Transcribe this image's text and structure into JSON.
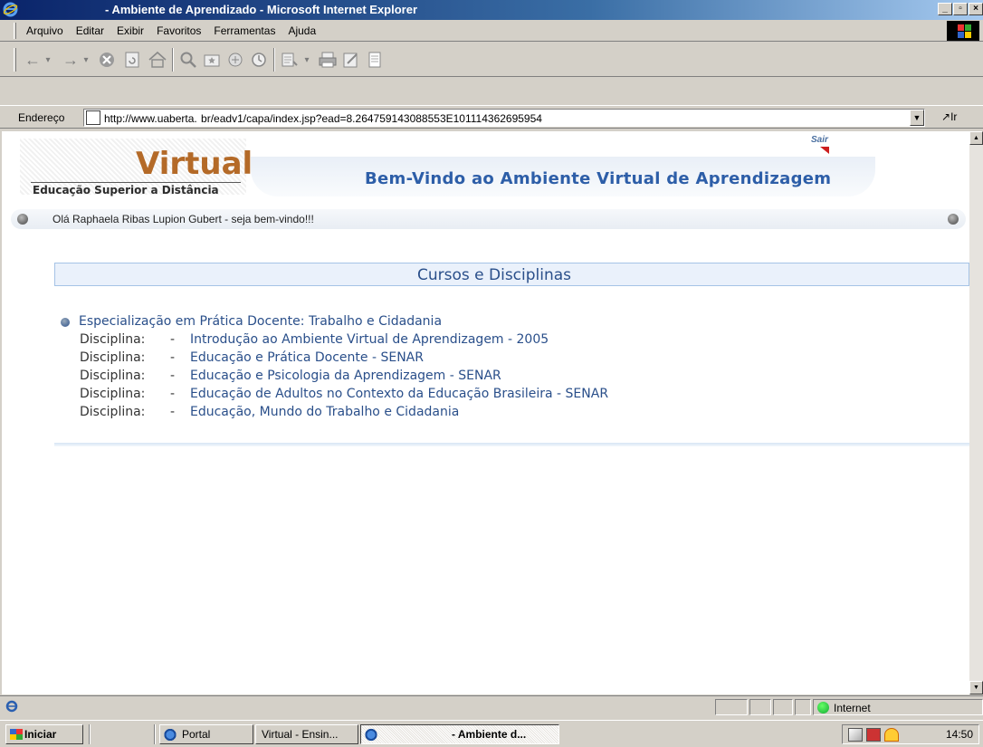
{
  "window": {
    "title": "- Ambiente de Aprendizado - Microsoft Internet Explorer",
    "caption_buttons": [
      "_",
      "▫",
      "×"
    ]
  },
  "menu": {
    "items": [
      "Arquivo",
      "Editar",
      "Exibir",
      "Favoritos",
      "Ferramentas",
      "Ajuda"
    ]
  },
  "toolbar": {
    "icons": [
      "back-icon",
      "forward-icon",
      "stop-icon",
      "refresh-icon",
      "home-icon",
      "search-icon",
      "favorites-icon",
      "media-icon",
      "history-icon",
      "mail-icon",
      "print-icon",
      "edit-icon",
      "discuss-icon"
    ]
  },
  "address": {
    "label": "Endereço",
    "url": "http://www.uaberta.         br/eadv1/capa/index.jsp?ead=8.264759143088553E101114362695954",
    "go_label": "Ir"
  },
  "site": {
    "logo_title": "Virtual",
    "logo_subtitle": "Educação Superior a Distância",
    "banner_title": "Bem-Vindo ao Ambiente Virtual de Aprendizagem",
    "logout_label": "Sair",
    "welcome": "Olá Raphaela Ribas Lupion Gubert - seja bem-vindo!!!"
  },
  "courses": {
    "section_title": "Cursos e Disciplinas",
    "course_name": "Especialização em Prática Docente: Trabalho e Cidadania",
    "discipline_label": "Disciplina:",
    "dash": "-",
    "disciplines": [
      "Introdução ao Ambiente Virtual de Aprendizagem - 2005",
      "Educação e Prática Docente - SENAR",
      "Educação e Psicologia da Aprendizagem - SENAR",
      "Educação de Adultos no Contexto da Educação Brasileira - SENAR",
      "Educação, Mundo do Trabalho e Cidadania"
    ]
  },
  "status": {
    "zone": "Internet"
  },
  "taskbar": {
    "start_label": "Iniciar",
    "tasks": [
      "Portal",
      "Virtual - Ensin...",
      "- Ambiente d..."
    ],
    "clock": "14:50"
  }
}
